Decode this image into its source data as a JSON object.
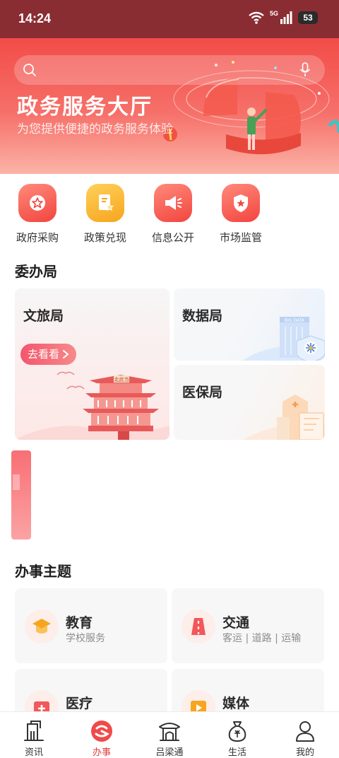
{
  "status": {
    "time": "14:24",
    "network": "5G",
    "battery": "53"
  },
  "banner": {
    "title": "政务服务大厅",
    "subtitle": "为您提供便捷的政务服务体验",
    "search_placeholder": ""
  },
  "quick_actions": [
    {
      "label": "政府采购",
      "icon": "star-badge-icon"
    },
    {
      "label": "政策兑现",
      "icon": "document-star-icon"
    },
    {
      "label": "信息公开",
      "icon": "megaphone-icon"
    },
    {
      "label": "市场监管",
      "icon": "police-shield-icon"
    }
  ],
  "bureaus": {
    "title": "委办局",
    "culture": {
      "title": "文旅局",
      "button": "去看看",
      "sign": "北武当"
    },
    "data": {
      "title": "数据局",
      "sign": "BIG DATA"
    },
    "medical": {
      "title": "医保局"
    }
  },
  "themes": {
    "title": "办事主题",
    "items": [
      {
        "title": "教育",
        "subtitle": "学校服务",
        "icon": "graduation-cap-icon"
      },
      {
        "title": "交通",
        "subtitle": "客运 | 道路 | 运输",
        "icon": "road-icon"
      },
      {
        "title": "医疗",
        "subtitle": "",
        "icon": "medical-kit-icon"
      },
      {
        "title": "媒体",
        "subtitle": "",
        "icon": "video-play-icon"
      }
    ]
  },
  "bottom_nav": [
    {
      "label": "资讯",
      "icon": "news-icon",
      "active": false
    },
    {
      "label": "办事",
      "icon": "service-icon",
      "active": true
    },
    {
      "label": "吕梁通",
      "icon": "pavilion-icon",
      "active": false
    },
    {
      "label": "生活",
      "icon": "life-bag-icon",
      "active": false
    },
    {
      "label": "我的",
      "icon": "user-icon",
      "active": false
    }
  ],
  "colors": {
    "accent": "#e33d3d",
    "banner_top": "#f24c47",
    "status_bar": "#8a2d33"
  }
}
